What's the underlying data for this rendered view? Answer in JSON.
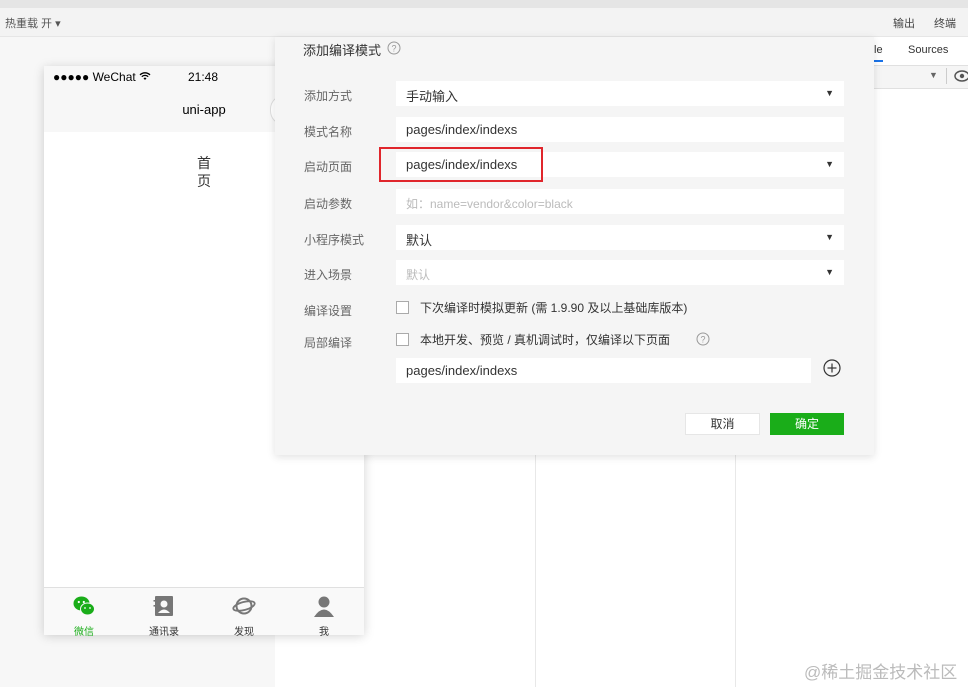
{
  "toolbar": {
    "hot_reload": "热重载 开",
    "output": "输出",
    "terminal": "终端"
  },
  "devtools": {
    "tab_console_partial": "le",
    "tab_sources": "Sources"
  },
  "simulator": {
    "signal": "●●●●● WeChat",
    "time": "21:48",
    "nav_title": "uni-app",
    "page_text": "首页",
    "tabs": [
      {
        "label": "微信",
        "icon": "wechat-icon",
        "active": true
      },
      {
        "label": "通讯录",
        "icon": "contacts-icon",
        "active": false
      },
      {
        "label": "发现",
        "icon": "discover-icon",
        "active": false
      },
      {
        "label": "我",
        "icon": "profile-icon",
        "active": false
      }
    ]
  },
  "dialog": {
    "title": "添加编译模式",
    "rows": {
      "add_method": {
        "label": "添加方式",
        "value": "手动输入"
      },
      "mode_name": {
        "label": "模式名称",
        "value": "pages/index/indexs"
      },
      "start_page": {
        "label": "启动页面",
        "value": "pages/index/indexs"
      },
      "start_params": {
        "label": "启动参数",
        "placeholder": "如：name=vendor&color=black"
      },
      "miniprogram_mode": {
        "label": "小程序模式",
        "value": "默认"
      },
      "enter_scene": {
        "label": "进入场景",
        "placeholder": "默认"
      },
      "compile_settings": {
        "label": "编译设置",
        "checkbox_text": "下次编译时模拟更新 (需 1.9.90 及以上基础库版本)"
      },
      "partial_compile": {
        "label": "局部编译",
        "checkbox_text": "本地开发、预览 / 真机调试时，仅编译以下页面",
        "page_value": "pages/index/indexs"
      }
    },
    "cancel_label": "取消",
    "ok_label": "确定"
  },
  "watermark": "@稀土掘金技术社区",
  "colors": {
    "accent_green": "#1aad19",
    "highlight_red": "#e0262c",
    "devtools_blue": "#1a73e8"
  }
}
